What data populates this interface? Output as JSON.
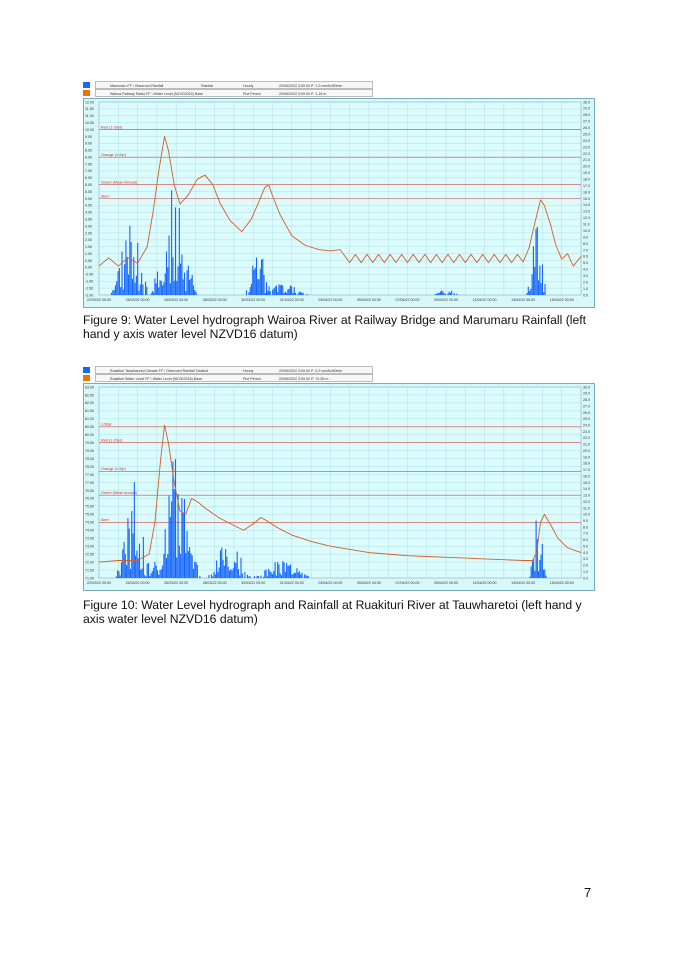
{
  "figures": [
    {
      "id": "fig9",
      "header_rows": [
        {
          "color": "#1565ff",
          "series": "Marumaru FF \\ Observed Rainfall",
          "kind": "Rainfall",
          "agg": "Hourly",
          "stat": "20/06/2022 3:00:00 P: 1.0 mm/hr/60min"
        },
        {
          "color": "#f07000",
          "series": "Wairoa Railway Radio FF \\ Water Level (NZVD2016) Base",
          "kind": "",
          "agg": "Plot Period",
          "stat": "20/06/2022 3:00:00 P: 1.18 m"
        }
      ],
      "caption": "Figure 9:  Water Level hydrograph Wairoa River at Railway Bridge and Marumaru Rainfall (left hand y axis water level NZVD16 datum)",
      "chart_data": {
        "type": "line",
        "x_ticks": [
          "22/03/22 00:00",
          "24/03/22 00:00",
          "26/03/22 00:00",
          "28/03/22 00:00",
          "30/03/22 00:00",
          "01/04/22 00:00",
          "03/04/22 00:00",
          "05/04/22 00:00",
          "07/04/22 00:00",
          "09/04/22 00:00",
          "11/04/22 00:00",
          "13/04/22 00:00",
          "15/04/22 00:00"
        ],
        "left_ticks": [
          "12.00",
          "11.50",
          "11.00",
          "10.50",
          "10.00",
          "9.50",
          "9.00",
          "8.50",
          "8.00",
          "7.50",
          "7.00",
          "6.50",
          "6.00",
          "5.50",
          "5.00",
          "4.50",
          "4.00",
          "3.50",
          "3.00",
          "2.50",
          "2.00",
          "1.50",
          "1.00",
          "0.50",
          "0.00",
          "-0.50",
          "-1.00",
          "-1.50",
          "-2.00"
        ],
        "right_ticks": [
          "30.0",
          "29.0",
          "28.0",
          "27.0",
          "26.0",
          "25.0",
          "24.0",
          "23.0",
          "22.0",
          "21.0",
          "20.0",
          "19.0",
          "18.0",
          "17.0",
          "16.0",
          "15.0",
          "14.0",
          "13.0",
          "12.0",
          "11.0",
          "10.0",
          "9.0",
          "8.0",
          "7.0",
          "6.0",
          "5.0",
          "4.0",
          "3.0",
          "2.0",
          "1.0",
          "0.0"
        ],
        "ylim_left": [
          -2,
          12
        ],
        "ylim_right": [
          0,
          30
        ],
        "days": 25,
        "thresholds": [
          {
            "label": "Red (1-20yr)",
            "value": 10
          },
          {
            "label": "Orange (1-5yr)",
            "value": 8
          },
          {
            "label": "Green (Mean Annual)",
            "value": 6
          },
          {
            "label": "Alert",
            "value": 5
          }
        ],
        "water_level": [
          [
            0.0,
            0.1
          ],
          [
            0.5,
            0.7
          ],
          [
            1.0,
            0.1
          ],
          [
            1.5,
            0.7
          ],
          [
            2.0,
            0.3
          ],
          [
            2.5,
            1.5
          ],
          [
            2.8,
            4.0
          ],
          [
            3.1,
            7.0
          ],
          [
            3.4,
            9.5
          ],
          [
            3.6,
            8.5
          ],
          [
            3.9,
            6.0
          ],
          [
            4.2,
            4.6
          ],
          [
            4.6,
            5.2
          ],
          [
            5.1,
            6.4
          ],
          [
            5.5,
            6.7
          ],
          [
            5.9,
            6.0
          ],
          [
            6.3,
            4.6
          ],
          [
            6.8,
            3.4
          ],
          [
            7.4,
            2.6
          ],
          [
            7.9,
            3.5
          ],
          [
            8.3,
            4.8
          ],
          [
            8.6,
            5.8
          ],
          [
            8.8,
            6.0
          ],
          [
            9.0,
            5.2
          ],
          [
            9.4,
            3.8
          ],
          [
            10.0,
            2.3
          ],
          [
            10.7,
            1.6
          ],
          [
            11.4,
            1.3
          ],
          [
            12.0,
            1.2
          ],
          [
            12.5,
            1.3
          ],
          [
            13.0,
            0.35
          ],
          [
            13.3,
            0.95
          ],
          [
            13.6,
            0.35
          ],
          [
            13.9,
            0.95
          ],
          [
            14.2,
            0.35
          ],
          [
            14.5,
            0.95
          ],
          [
            14.8,
            0.35
          ],
          [
            15.1,
            0.95
          ],
          [
            15.4,
            0.35
          ],
          [
            15.7,
            0.95
          ],
          [
            16.0,
            0.35
          ],
          [
            16.3,
            0.95
          ],
          [
            16.6,
            0.35
          ],
          [
            16.9,
            0.95
          ],
          [
            17.2,
            0.35
          ],
          [
            17.5,
            0.95
          ],
          [
            17.8,
            0.35
          ],
          [
            18.1,
            0.95
          ],
          [
            18.4,
            0.35
          ],
          [
            18.7,
            0.95
          ],
          [
            19.0,
            0.35
          ],
          [
            19.3,
            0.95
          ],
          [
            19.6,
            0.35
          ],
          [
            19.9,
            0.95
          ],
          [
            20.2,
            0.35
          ],
          [
            20.5,
            0.95
          ],
          [
            20.8,
            0.35
          ],
          [
            21.1,
            0.95
          ],
          [
            21.4,
            0.35
          ],
          [
            21.7,
            0.95
          ],
          [
            22.0,
            0.4
          ],
          [
            22.3,
            1.4
          ],
          [
            22.6,
            3.2
          ],
          [
            22.9,
            4.9
          ],
          [
            23.1,
            4.5
          ],
          [
            23.4,
            3.2
          ],
          [
            23.7,
            1.6
          ],
          [
            24.0,
            0.6
          ],
          [
            24.3,
            1.0
          ],
          [
            24.6,
            0.1
          ],
          [
            25.0,
            0.8
          ]
        ],
        "rainfall_bursts": [
          {
            "day": 1.6,
            "width": 1.9,
            "peak": 14,
            "seed": 3
          },
          {
            "day": 3.9,
            "width": 2.4,
            "peak": 17,
            "seed": 7
          },
          {
            "day": 8.3,
            "width": 1.3,
            "peak": 10,
            "seed": 11
          },
          {
            "day": 9.6,
            "width": 2.5,
            "peak": 2,
            "seed": 5
          },
          {
            "day": 18.0,
            "width": 1.5,
            "peak": 1,
            "seed": 2
          },
          {
            "day": 22.7,
            "width": 1.0,
            "peak": 12,
            "seed": 9
          }
        ]
      }
    },
    {
      "id": "fig10",
      "header_rows": [
        {
          "color": "#1565ff",
          "series": "Ruakituri Tauwharetoi Climate FF \\ Observed Rainfall Totalled",
          "kind": "",
          "agg": "Hourly",
          "stat": "20/06/2022 3:00:00 P: 0.2 mm/hr/60min"
        },
        {
          "color": "#f07000",
          "series": "Ruakituri Water Level FF \\ Water Level (NZVD2016) Base",
          "kind": "",
          "agg": "Plot Period",
          "stat": "20/06/2022 3:00:00 P: 72.55 m"
        }
      ],
      "caption": "Figure 10:  Water Level hydrograph and Rainfall at Ruakituri River at Tauwharetoi (left hand y axis water level NZVD16 datum)",
      "chart_data": {
        "type": "line",
        "x_ticks": [
          "22/03/22 00:00",
          "24/03/22 00:00",
          "26/03/22 00:00",
          "28/03/22 00:00",
          "30/03/22 00:00",
          "01/04/22 00:00",
          "03/04/22 00:00",
          "05/04/22 00:00",
          "07/04/22 00:00",
          "09/04/22 00:00",
          "11/04/22 00:00",
          "13/04/22 00:00",
          "15/04/22 00:00"
        ],
        "left_ticks": [
          "83.00",
          "82.50",
          "82.00",
          "81.50",
          "81.00",
          "80.50",
          "80.00",
          "79.50",
          "79.00",
          "78.50",
          "78.00",
          "77.50",
          "77.00",
          "76.50",
          "76.00",
          "75.50",
          "75.00",
          "74.50",
          "74.00",
          "73.50",
          "73.00",
          "72.50",
          "72.00",
          "71.50",
          "71.00"
        ],
        "right_ticks": [
          "30.0",
          "29.0",
          "28.0",
          "27.0",
          "26.0",
          "25.0",
          "24.0",
          "23.0",
          "22.0",
          "21.0",
          "20.0",
          "19.0",
          "18.0",
          "17.0",
          "16.0",
          "15.0",
          "14.0",
          "13.0",
          "12.0",
          "11.0",
          "10.0",
          "9.0",
          "8.0",
          "7.0",
          "6.0",
          "5.0",
          "4.0",
          "3.0",
          "2.0",
          "1.0",
          "0.0"
        ],
        "ylim_left": [
          71,
          83
        ],
        "ylim_right": [
          0,
          30
        ],
        "days": 25,
        "thresholds": [
          {
            "label": "1-50yr",
            "value": 80.5
          },
          {
            "label": "Red (1-20yr)",
            "value": 79.5
          },
          {
            "label": "Orange (1-5yr)",
            "value": 77.7
          },
          {
            "label": "Green (Mean annual)",
            "value": 76.2
          },
          {
            "label": "Alert",
            "value": 74.5
          }
        ],
        "water_level": [
          [
            0.0,
            72.0
          ],
          [
            1.0,
            72.1
          ],
          [
            2.0,
            72.1
          ],
          [
            2.6,
            72.5
          ],
          [
            2.9,
            74.5
          ],
          [
            3.2,
            78.5
          ],
          [
            3.4,
            80.6
          ],
          [
            3.6,
            79.5
          ],
          [
            3.9,
            77.0
          ],
          [
            4.2,
            75.2
          ],
          [
            4.5,
            75.0
          ],
          [
            4.8,
            76.0
          ],
          [
            5.1,
            75.8
          ],
          [
            5.5,
            75.4
          ],
          [
            6.2,
            74.8
          ],
          [
            7.0,
            74.3
          ],
          [
            7.5,
            74.0
          ],
          [
            8.0,
            74.4
          ],
          [
            8.4,
            74.8
          ],
          [
            8.7,
            74.6
          ],
          [
            9.2,
            74.2
          ],
          [
            10.0,
            73.7
          ],
          [
            11.0,
            73.3
          ],
          [
            12.0,
            73.0
          ],
          [
            13.0,
            72.8
          ],
          [
            14.0,
            72.6
          ],
          [
            15.0,
            72.5
          ],
          [
            16.0,
            72.4
          ],
          [
            17.0,
            72.35
          ],
          [
            18.0,
            72.3
          ],
          [
            19.0,
            72.25
          ],
          [
            20.0,
            72.2
          ],
          [
            21.0,
            72.15
          ],
          [
            22.0,
            72.1
          ],
          [
            22.5,
            72.1
          ],
          [
            22.7,
            72.6
          ],
          [
            22.9,
            74.5
          ],
          [
            23.1,
            75.0
          ],
          [
            23.4,
            74.4
          ],
          [
            23.8,
            73.5
          ],
          [
            24.3,
            72.9
          ],
          [
            25.0,
            72.6
          ]
        ],
        "rainfall_bursts": [
          {
            "day": 1.8,
            "width": 1.8,
            "peak": 16,
            "seed": 4
          },
          {
            "day": 4.0,
            "width": 2.6,
            "peak": 20,
            "seed": 8
          },
          {
            "day": 6.8,
            "width": 2.2,
            "peak": 8,
            "seed": 6
          },
          {
            "day": 9.5,
            "width": 3.0,
            "peak": 3,
            "seed": 1
          },
          {
            "day": 22.8,
            "width": 0.9,
            "peak": 13,
            "seed": 10
          }
        ]
      }
    }
  ],
  "page_number": "7"
}
